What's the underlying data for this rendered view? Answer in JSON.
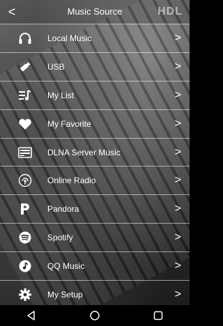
{
  "header": {
    "title": "Music Source",
    "back_glyph": "<",
    "logo": "HDL"
  },
  "items": [
    {
      "label": "Local Music",
      "icon": "headphones-icon"
    },
    {
      "label": "USB",
      "icon": "usb-icon"
    },
    {
      "label": "My List",
      "icon": "playlist-icon"
    },
    {
      "label": "My Favorite",
      "icon": "heart-icon"
    },
    {
      "label": "DLNA Server Music",
      "icon": "server-icon"
    },
    {
      "label": "Online Radio",
      "icon": "radio-icon"
    },
    {
      "label": "Pandora",
      "icon": "pandora-icon"
    },
    {
      "label": "Spotify",
      "icon": "spotify-icon"
    },
    {
      "label": "QQ Music",
      "icon": "qq-music-icon"
    },
    {
      "label": "My Setup",
      "icon": "gear-icon"
    }
  ],
  "chevron": ">",
  "navbar": {
    "back": "back-icon",
    "home": "home-icon",
    "recents": "recents-icon"
  }
}
